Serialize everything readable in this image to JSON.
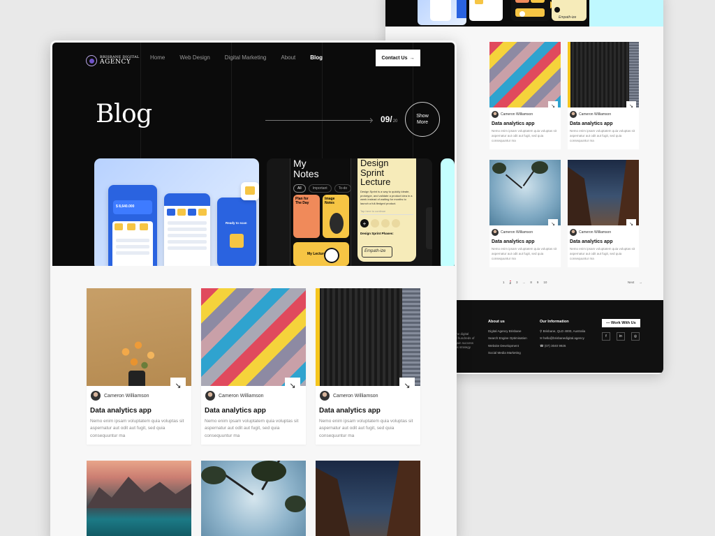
{
  "brand": {
    "line1": "BRISBANE DIGITAL",
    "line2": "AGENCY"
  },
  "nav": {
    "items": [
      "Home",
      "Web Design",
      "Digital Marketing",
      "About",
      "Blog"
    ],
    "active": "Blog",
    "cta": "Contact Us"
  },
  "hero": {
    "title": "Blog",
    "counter": "09/",
    "total": "20",
    "show_more": "Show More"
  },
  "slides": {
    "notes_title": "My Notes",
    "notes_pills": [
      "All",
      "Important",
      "To-do"
    ],
    "card_plan": "Plan for The Day",
    "card_image": "Image Notes",
    "card_lectures": "My Lectures",
    "design_title": "Design Sprint Lecture",
    "design_text": "Design Sprint is a way to quickly ideate, prototype, and validate a product idea in a week instead of waiting for months to launch a full-fledged product.",
    "design_input": "Tap here to continue",
    "design_phases": "Design Sprint Phases:",
    "design_signature": "Empath-ize",
    "banking": {
      "balance": "$ 8,640.000",
      "ready": "Ready to scan"
    }
  },
  "cards": [
    {
      "author": "Cameron Williamson",
      "title": "Data analytics app",
      "desc": "Nemo enim ipsam voluptatem quia voluptas sit aspernatur aut odit aut fugit, sed quia consequuntur ma"
    },
    {
      "author": "Cameron Williamson",
      "title": "Data analytics app",
      "desc": "Nemo enim ipsam voluptatem quia voluptas sit aspernatur aut odit aut fugit, sed quia consequuntur ma"
    },
    {
      "author": "Cameron Williamson",
      "title": "Data analytics app",
      "desc": "Nemo enim ipsam voluptatem quia voluptas sit aspernatur aut odit aut fugit, sed quia consequuntur ma"
    }
  ],
  "back_cards": [
    {
      "author": "Cameron Williamson",
      "title": "Data analytics app",
      "desc": "Nemo enim ipsam voluptatem quia voluptas sit aspernatur aut odit aut fugit, sed quia consequuntur ma"
    },
    {
      "author": "Cameron Williamson",
      "title": "Data analytics app",
      "desc": "Nemo enim ipsam voluptatem quia voluptas sit aspernatur aut odit aut fugit, sed quia consequuntur ma"
    },
    {
      "author": "Cameron Williamson",
      "title": "Data analytics app",
      "desc": "Nemo enim ipsam voluptatem quia voluptas sit aspernatur aut odit aut fugit, sed quia consequuntur ma"
    },
    {
      "author": "Cameron Williamson",
      "title": "Data analytics app",
      "desc": "Nemo enim ipsam voluptatem quia voluptas sit aspernatur aut odit aut fugit, sed quia consequuntur ma"
    }
  ],
  "pagination": {
    "pages": [
      "1",
      "2",
      "3",
      "...",
      "8",
      "9",
      "10"
    ],
    "next": "Next"
  },
  "footer": {
    "intro_fragments": [
      "the digital",
      "d hundreds of",
      "gain success",
      "ns strategy"
    ],
    "about_title": "About us",
    "about_links": [
      "Digital Agency Brisbane",
      "Search Engine Optimisation",
      "Website Development",
      "Social Media Marketing"
    ],
    "info_title": "Our Information",
    "address": "Brisbane, QLD 4000, Australia",
    "email": "hello@brisbanedigital.agency",
    "phone": "(07) 3040 9926",
    "work_btn": "Work With Us"
  },
  "colors": {
    "hero_bg": "#0b0b0b",
    "page_bg": "#f7f7f7",
    "notes_yellow": "#f6ebb9",
    "banking_blue": "#2a63e0"
  }
}
